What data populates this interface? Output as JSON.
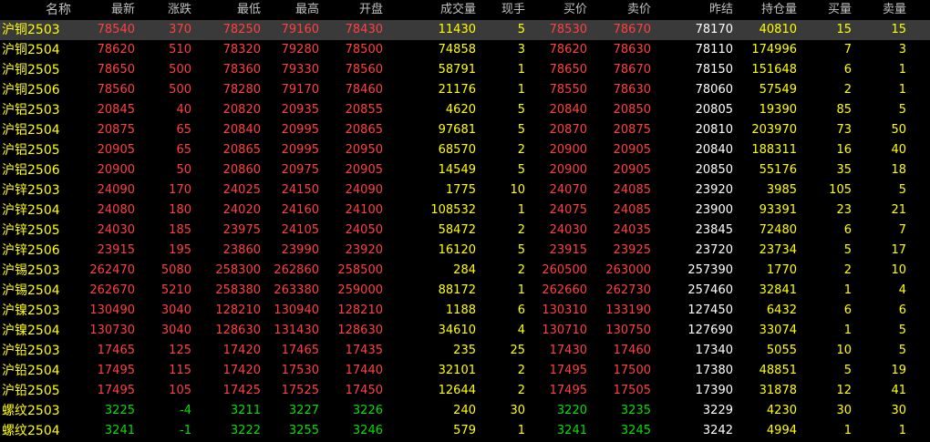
{
  "colors": {
    "background": "#000000",
    "up": "#ff4040",
    "down": "#00e000",
    "neutral": "#ffffff",
    "name": "#ffff00",
    "volume": "#ffff00",
    "header": "#c0c0c0",
    "selected_row": "#3a3a3a"
  },
  "columns": [
    {
      "key": "name",
      "label": "名称"
    },
    {
      "key": "last",
      "label": "最新"
    },
    {
      "key": "chg",
      "label": "涨跌"
    },
    {
      "key": "low",
      "label": "最低"
    },
    {
      "key": "high",
      "label": "最高"
    },
    {
      "key": "open",
      "label": "开盘"
    },
    {
      "key": "vol",
      "label": "成交量"
    },
    {
      "key": "cur",
      "label": "现手"
    },
    {
      "key": "bid",
      "label": "买价"
    },
    {
      "key": "ask",
      "label": "卖价"
    },
    {
      "key": "prev",
      "label": "昨结"
    },
    {
      "key": "oi",
      "label": "持仓量"
    },
    {
      "key": "bidv",
      "label": "买量"
    },
    {
      "key": "askv",
      "label": "卖量"
    }
  ],
  "selected_row": 0,
  "rows": [
    {
      "name": "沪铜2503",
      "last": "78540",
      "chg": "370",
      "low": "78250",
      "high": "79160",
      "open": "78430",
      "vol": "11430",
      "cur": "5",
      "bid": "78530",
      "ask": "78670",
      "prev": "78170",
      "oi": "40810",
      "bidv": "15",
      "askv": "15",
      "dir": "up"
    },
    {
      "name": "沪铜2504",
      "last": "78620",
      "chg": "510",
      "low": "78320",
      "high": "79280",
      "open": "78500",
      "vol": "74858",
      "cur": "3",
      "bid": "78620",
      "ask": "78630",
      "prev": "78110",
      "oi": "174996",
      "bidv": "7",
      "askv": "3",
      "dir": "up"
    },
    {
      "name": "沪铜2505",
      "last": "78650",
      "chg": "500",
      "low": "78360",
      "high": "79330",
      "open": "78560",
      "vol": "58791",
      "cur": "1",
      "bid": "78650",
      "ask": "78670",
      "prev": "78150",
      "oi": "151648",
      "bidv": "6",
      "askv": "1",
      "dir": "up"
    },
    {
      "name": "沪铜2506",
      "last": "78560",
      "chg": "500",
      "low": "78280",
      "high": "79170",
      "open": "78460",
      "vol": "21176",
      "cur": "1",
      "bid": "78550",
      "ask": "78630",
      "prev": "78060",
      "oi": "57549",
      "bidv": "2",
      "askv": "1",
      "dir": "up"
    },
    {
      "name": "沪铝2503",
      "last": "20845",
      "chg": "40",
      "low": "20820",
      "high": "20935",
      "open": "20855",
      "vol": "4620",
      "cur": "5",
      "bid": "20840",
      "ask": "20850",
      "prev": "20805",
      "oi": "19390",
      "bidv": "85",
      "askv": "5",
      "dir": "up"
    },
    {
      "name": "沪铝2504",
      "last": "20875",
      "chg": "65",
      "low": "20840",
      "high": "20995",
      "open": "20865",
      "vol": "97681",
      "cur": "5",
      "bid": "20870",
      "ask": "20875",
      "prev": "20810",
      "oi": "203970",
      "bidv": "73",
      "askv": "50",
      "dir": "up"
    },
    {
      "name": "沪铝2505",
      "last": "20905",
      "chg": "65",
      "low": "20865",
      "high": "20995",
      "open": "20950",
      "vol": "68570",
      "cur": "2",
      "bid": "20900",
      "ask": "20905",
      "prev": "20840",
      "oi": "188311",
      "bidv": "16",
      "askv": "40",
      "dir": "up"
    },
    {
      "name": "沪铝2506",
      "last": "20900",
      "chg": "50",
      "low": "20860",
      "high": "20975",
      "open": "20905",
      "vol": "14549",
      "cur": "5",
      "bid": "20900",
      "ask": "20905",
      "prev": "20850",
      "oi": "55176",
      "bidv": "35",
      "askv": "18",
      "dir": "up"
    },
    {
      "name": "沪锌2503",
      "last": "24090",
      "chg": "170",
      "low": "24025",
      "high": "24150",
      "open": "24090",
      "vol": "1775",
      "cur": "10",
      "bid": "24070",
      "ask": "24085",
      "prev": "23920",
      "oi": "3985",
      "bidv": "105",
      "askv": "5",
      "dir": "up"
    },
    {
      "name": "沪锌2504",
      "last": "24080",
      "chg": "180",
      "low": "24020",
      "high": "24160",
      "open": "24100",
      "vol": "108532",
      "cur": "1",
      "bid": "24075",
      "ask": "24085",
      "prev": "23900",
      "oi": "93391",
      "bidv": "23",
      "askv": "21",
      "dir": "up"
    },
    {
      "name": "沪锌2505",
      "last": "24030",
      "chg": "185",
      "low": "23975",
      "high": "24105",
      "open": "24050",
      "vol": "58472",
      "cur": "2",
      "bid": "24030",
      "ask": "24035",
      "prev": "23845",
      "oi": "72480",
      "bidv": "6",
      "askv": "7",
      "dir": "up"
    },
    {
      "name": "沪锌2506",
      "last": "23915",
      "chg": "195",
      "low": "23860",
      "high": "23990",
      "open": "23920",
      "vol": "16120",
      "cur": "5",
      "bid": "23915",
      "ask": "23925",
      "prev": "23720",
      "oi": "23734",
      "bidv": "5",
      "askv": "17",
      "dir": "up"
    },
    {
      "name": "沪锡2503",
      "last": "262470",
      "chg": "5080",
      "low": "258300",
      "high": "262860",
      "open": "258500",
      "vol": "284",
      "cur": "2",
      "bid": "260500",
      "ask": "263000",
      "prev": "257390",
      "oi": "1770",
      "bidv": "2",
      "askv": "10",
      "dir": "up"
    },
    {
      "name": "沪锡2504",
      "last": "262670",
      "chg": "5210",
      "low": "258380",
      "high": "263380",
      "open": "259000",
      "vol": "88172",
      "cur": "1",
      "bid": "262660",
      "ask": "262730",
      "prev": "257460",
      "oi": "32841",
      "bidv": "1",
      "askv": "4",
      "dir": "up"
    },
    {
      "name": "沪镍2503",
      "last": "130490",
      "chg": "3040",
      "low": "128210",
      "high": "130940",
      "open": "128210",
      "vol": "1188",
      "cur": "6",
      "bid": "130310",
      "ask": "133190",
      "prev": "127450",
      "oi": "6432",
      "bidv": "6",
      "askv": "6",
      "dir": "up"
    },
    {
      "name": "沪镍2504",
      "last": "130730",
      "chg": "3040",
      "low": "128630",
      "high": "131430",
      "open": "128630",
      "vol": "34610",
      "cur": "4",
      "bid": "130710",
      "ask": "130750",
      "prev": "127690",
      "oi": "33074",
      "bidv": "1",
      "askv": "5",
      "dir": "up"
    },
    {
      "name": "沪铅2503",
      "last": "17465",
      "chg": "125",
      "low": "17420",
      "high": "17465",
      "open": "17435",
      "vol": "235",
      "cur": "25",
      "bid": "17430",
      "ask": "17460",
      "prev": "17340",
      "oi": "5055",
      "bidv": "10",
      "askv": "5",
      "dir": "up"
    },
    {
      "name": "沪铅2504",
      "last": "17495",
      "chg": "115",
      "low": "17420",
      "high": "17530",
      "open": "17440",
      "vol": "32101",
      "cur": "2",
      "bid": "17495",
      "ask": "17500",
      "prev": "17380",
      "oi": "48851",
      "bidv": "5",
      "askv": "19",
      "dir": "up"
    },
    {
      "name": "沪铅2505",
      "last": "17495",
      "chg": "105",
      "low": "17425",
      "high": "17525",
      "open": "17450",
      "vol": "12644",
      "cur": "2",
      "bid": "17495",
      "ask": "17505",
      "prev": "17390",
      "oi": "31878",
      "bidv": "12",
      "askv": "41",
      "dir": "up"
    },
    {
      "name": "螺纹2503",
      "last": "3225",
      "chg": "-4",
      "low": "3211",
      "high": "3227",
      "open": "3226",
      "vol": "240",
      "cur": "30",
      "bid": "3220",
      "ask": "3235",
      "prev": "3229",
      "oi": "4230",
      "bidv": "30",
      "askv": "30",
      "dir": "down"
    },
    {
      "name": "螺纹2504",
      "last": "3241",
      "chg": "-1",
      "low": "3222",
      "high": "3255",
      "open": "3246",
      "vol": "579",
      "cur": "1",
      "bid": "3241",
      "ask": "3245",
      "prev": "3242",
      "oi": "4994",
      "bidv": "1",
      "askv": "1",
      "dir": "down"
    }
  ]
}
